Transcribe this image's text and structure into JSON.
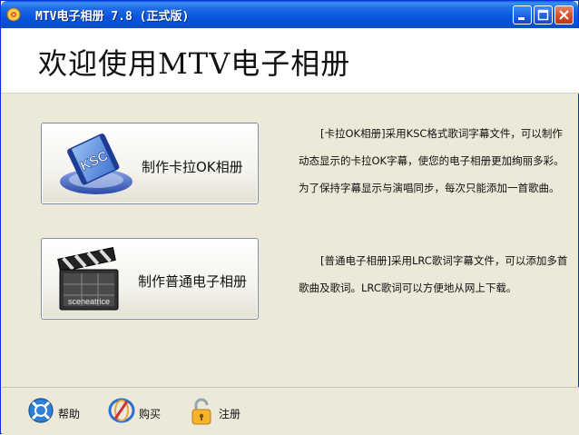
{
  "window": {
    "title": "MTV电子相册 7.8  (正式版)",
    "colors": {
      "titlebar": "#0a55dd",
      "close": "#d54b27",
      "background": "#ece9d8"
    }
  },
  "header": {
    "title": "欢迎使用MTV电子相册"
  },
  "actions": {
    "karaoke": {
      "label": "制作卡拉OK相册",
      "icon": "ksc-film-icon",
      "icon_text": "KSC",
      "description": "[卡拉OK相册]采用KSC格式歌词字幕文件，可以制作动态显示的卡拉OK字幕，使您的电子相册更加绚丽多彩。为了保持字幕显示与演唱同步，每次只能添加一首歌曲。"
    },
    "normal": {
      "label": "制作普通电子相册",
      "icon": "clapperboard-icon",
      "icon_text": "sceneatrice",
      "description": "[普通电子相册]采用LRC歌词字幕文件，可以添加多首歌曲及歌词。LRC歌词可以方便地从网上下载。"
    }
  },
  "footer": {
    "help": {
      "label": "帮助",
      "icon": "help-icon"
    },
    "buy": {
      "label": "购买",
      "icon": "buy-icon"
    },
    "register": {
      "label": "注册",
      "icon": "lock-icon"
    }
  }
}
